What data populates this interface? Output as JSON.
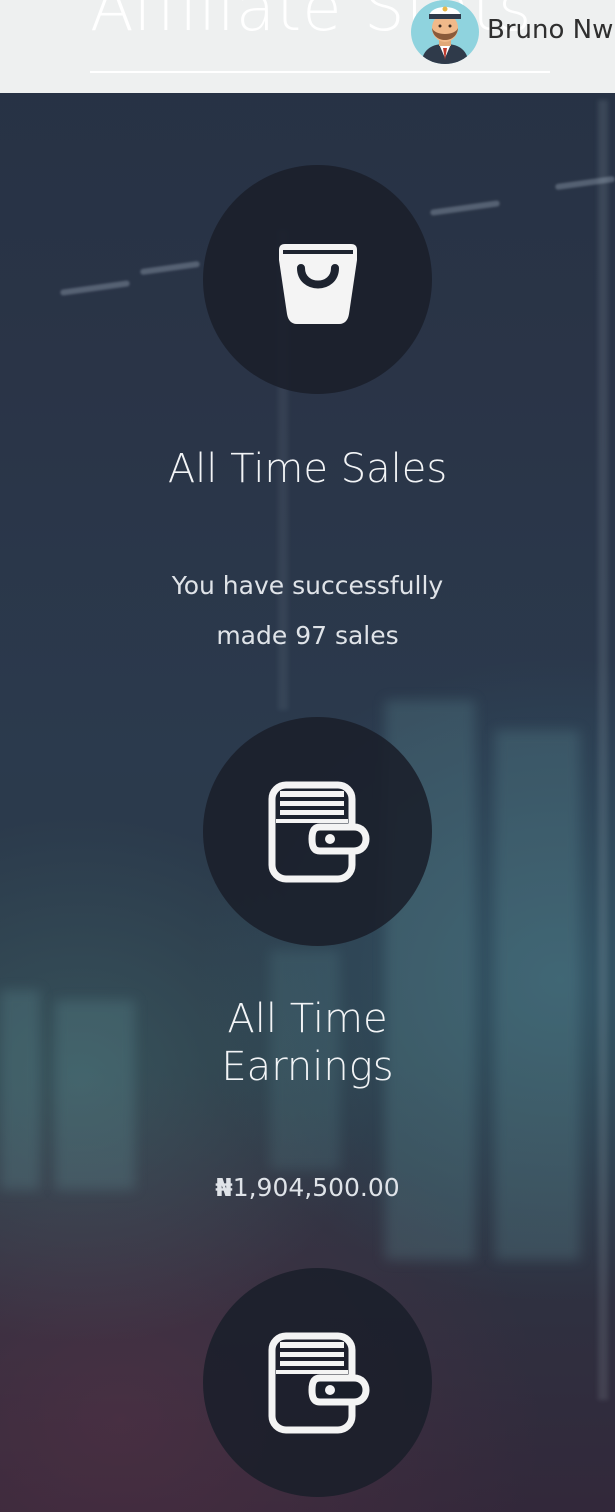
{
  "header": {
    "title": "Affiliate Stats",
    "user_name": "Bruno Nw",
    "avatar_icon": "user-avatar-icon"
  },
  "stats": [
    {
      "icon": "shopping-bag-icon",
      "title": "All Time Sales",
      "desc_line1": "You have successfully",
      "desc_line2": "made 97 sales"
    },
    {
      "icon": "wallet-icon",
      "title_line1": "All Time",
      "title_line2": "Earnings",
      "currency_symbol": "₦",
      "amount": "1,904,500.00"
    },
    {
      "icon": "wallet-icon"
    }
  ],
  "colors": {
    "header_bg": "#eef0f0",
    "circle_bg": "#1a1f2a",
    "text": "#f2f4f6"
  }
}
